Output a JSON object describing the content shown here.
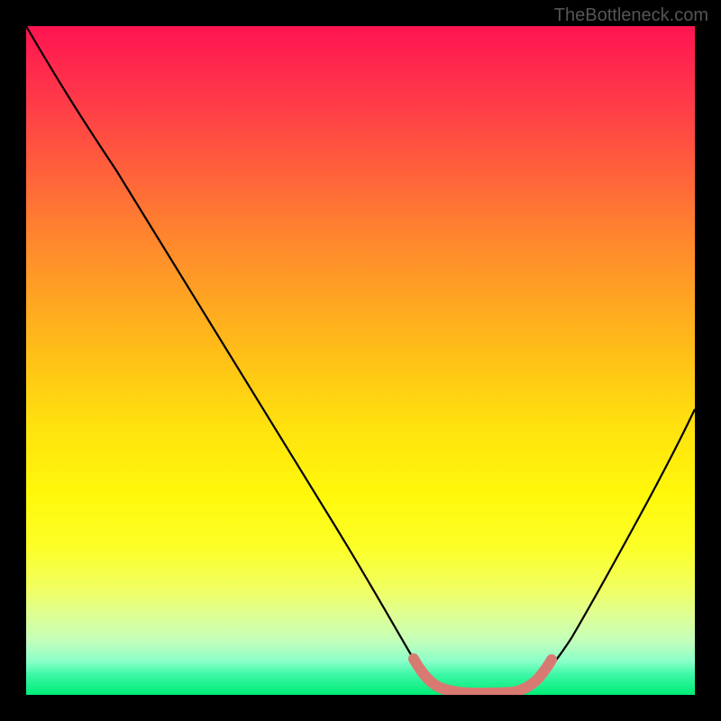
{
  "watermark": "TheBottleneck.com",
  "chart_data": {
    "type": "line",
    "title": "",
    "xlabel": "",
    "ylabel": "",
    "xlim": [
      0,
      100
    ],
    "ylim": [
      0,
      100
    ],
    "series": [
      {
        "name": "bottleneck-curve",
        "x": [
          0,
          5,
          10,
          15,
          20,
          25,
          30,
          35,
          40,
          45,
          50,
          55,
          58,
          60,
          62,
          65,
          68,
          70,
          72,
          74,
          76,
          78,
          80,
          85,
          90,
          95,
          100
        ],
        "values": [
          100,
          94,
          86,
          77,
          69,
          60,
          52,
          43,
          35,
          26,
          18,
          9,
          4,
          2,
          1,
          0.5,
          0.5,
          0.5,
          0.5,
          1,
          2,
          4,
          7,
          16,
          28,
          41,
          54
        ]
      }
    ],
    "highlight": {
      "name": "optimal-range",
      "x": [
        58,
        77
      ],
      "color": "#d87a72"
    },
    "gradient_colormap": "red-yellow-green (vertical, value-based)"
  }
}
